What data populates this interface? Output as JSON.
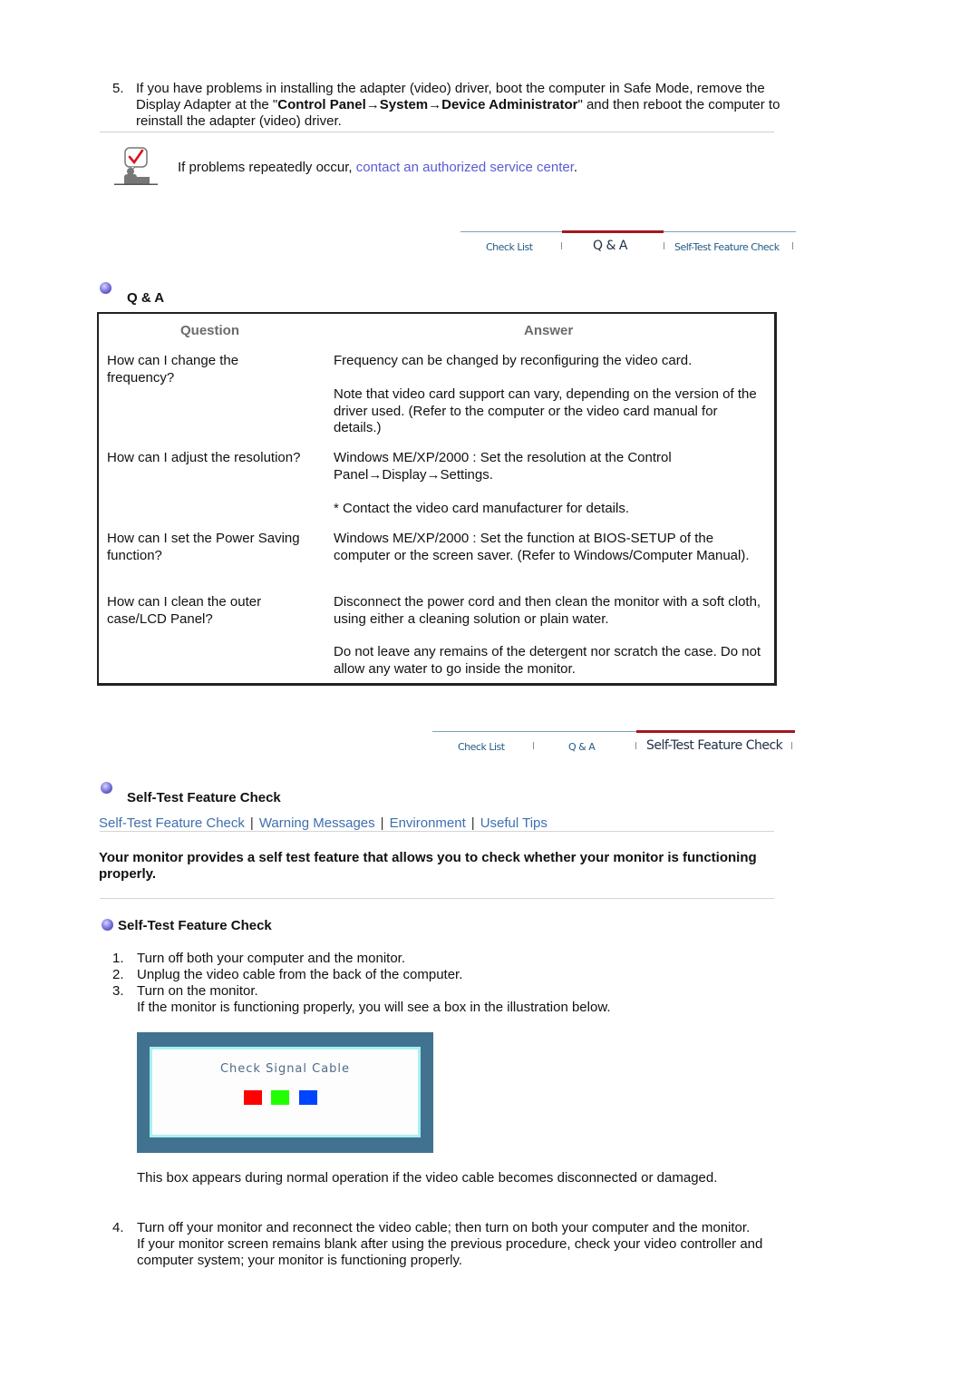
{
  "step5": {
    "number": "5.",
    "text_before": "If you have problems in installing the adapter (video) driver, boot the computer in Safe Mode, remove the Display Adapter at the \"",
    "path_bold": "Control Panel→System→Device Administrator",
    "text_after": "\" and then reboot the computer to reinstall the adapter (video) driver."
  },
  "note": {
    "icon": "checkmark-speech-person-icon",
    "text_before": "If problems repeatedly occur, ",
    "link": "contact an authorized service center",
    "text_after": "."
  },
  "tabs_top": {
    "items": [
      "Check List",
      "Q & A",
      "Self-Test Feature Check"
    ],
    "active": "Q & A"
  },
  "tabs_bottom": {
    "items": [
      "Check List",
      "Q & A",
      "Self-Test Feature Check"
    ],
    "active": "Self-Test Feature Check"
  },
  "qa": {
    "title": "Q & A",
    "headers": {
      "question": "Question",
      "answer": "Answer"
    },
    "rows": [
      {
        "question": "How can I change the frequency?",
        "answers": [
          "Frequency can be changed by reconfiguring the video card.",
          "Note that video card support can vary, depending on the version of the driver used. (Refer to the computer or the video card manual for details.)"
        ]
      },
      {
        "question": "How can I adjust the resolution?",
        "answers": [
          "Windows ME/XP/2000 : Set the resolution at the Control Panel→Display→Settings.",
          "* Contact the video card manufacturer for details."
        ]
      },
      {
        "question": "How can I set the Power Saving function?",
        "answers": [
          "Windows ME/XP/2000 : Set the function at BIOS-SETUP of the computer or the screen saver. (Refer to Windows/Computer Manual)."
        ]
      },
      {
        "question": "How can I clean the outer case/LCD Panel?",
        "answers": [
          "Disconnect the power cord and then clean the monitor with a soft cloth, using either a cleaning solution or plain water.",
          "Do not leave any remains of the detergent nor scratch the case. Do not allow any water to go inside the monitor."
        ]
      }
    ]
  },
  "selftest": {
    "title": "Self-Test Feature Check",
    "subnav": [
      "Self-Test Feature Check",
      "Warning Messages",
      "Environment",
      "Useful Tips"
    ],
    "intro": "Your monitor provides a self test feature that allows you to check whether your monitor is functioning properly.",
    "subtitle": "Self-Test Feature Check",
    "steps": [
      {
        "n": "1.",
        "text": "Turn off both your computer and the monitor."
      },
      {
        "n": "2.",
        "text": "Unplug the video cable from the back of the computer."
      },
      {
        "n": "3.",
        "text": "Turn on the monitor."
      }
    ],
    "step3_note": "If the monitor is functioning properly, you will see a box in the illustration below.",
    "illustration": {
      "message": "Check Signal Cable",
      "colors": [
        "#ff0000",
        "#22ff00",
        "#0044ff"
      ]
    },
    "after_illustration": "This box appears during normal operation if the video cable becomes disconnected or damaged.",
    "step4": {
      "n": "4.",
      "text": "Turn off your monitor and reconnect the video cable; then turn on both your computer and the monitor.",
      "note": "If your monitor screen remains blank after using the previous procedure, check your video controller and computer system; your monitor is functioning properly."
    }
  }
}
